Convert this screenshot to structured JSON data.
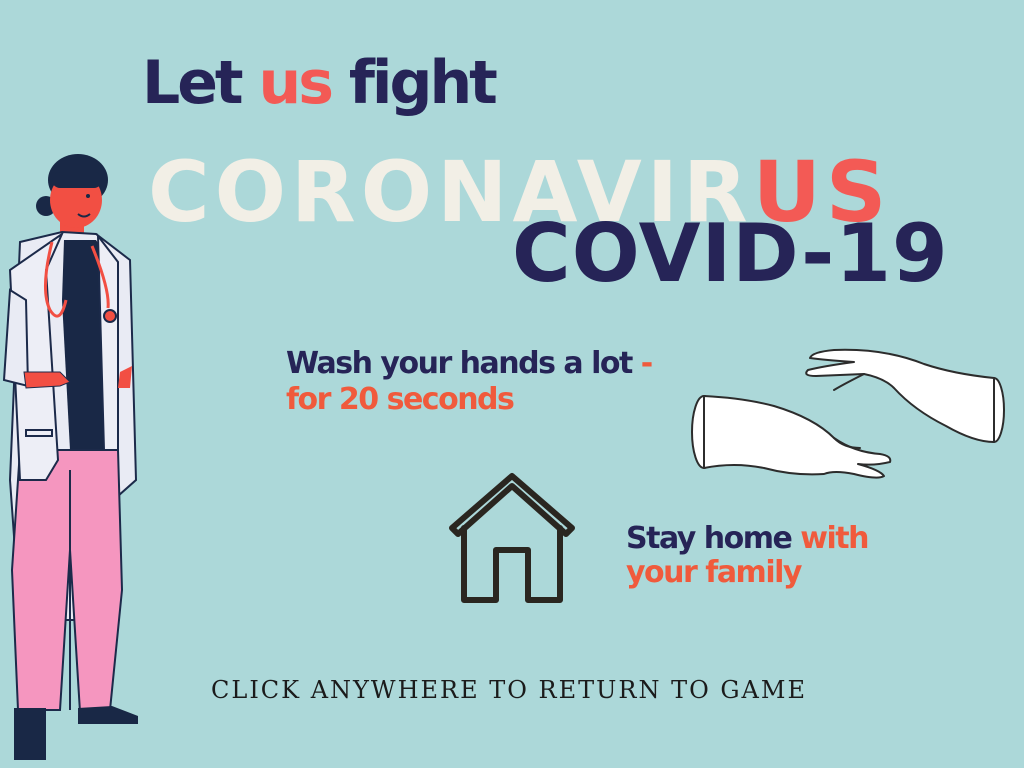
{
  "colors": {
    "background": "#acd8d9",
    "navy": "#262457",
    "coral": "#f05a3c",
    "red": "#f35a55",
    "cream": "#f2efe6"
  },
  "headline": {
    "part1": "Let ",
    "accent": "us",
    "part2": " fight"
  },
  "virus_word": {
    "main": "CORONAVIR",
    "tail": "US"
  },
  "covid_word": "COVID-19",
  "wash_tip": {
    "line1": "Wash your hands a lot ",
    "dash": "-",
    "line2": "for 20 seconds"
  },
  "stay_tip": {
    "line1a": "Stay home ",
    "line1b": "with",
    "line2": "your family"
  },
  "footer": "CLICK ANYWHERE TO RETURN TO GAME",
  "icons": [
    "doctor-illustration",
    "house-icon",
    "hands-illustration"
  ]
}
